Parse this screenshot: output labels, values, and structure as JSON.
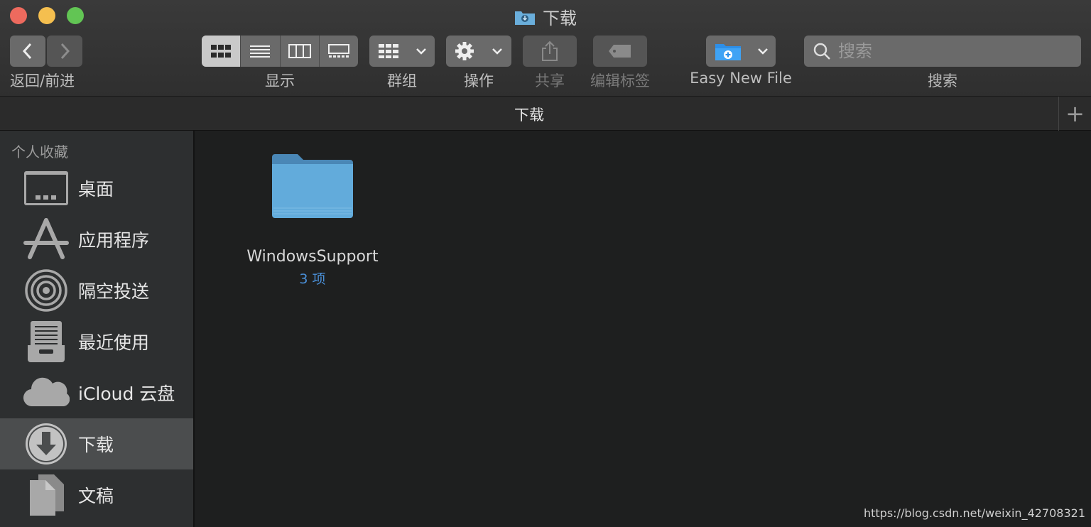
{
  "window": {
    "title": "下载"
  },
  "toolbar": {
    "nav_label": "返回/前进",
    "view_label": "显示",
    "group_label": "群组",
    "action_label": "操作",
    "share_label": "共享",
    "tags_label": "编辑标签",
    "easy_new_file_label": "Easy New File",
    "search_label": "搜索",
    "search_placeholder": "搜索"
  },
  "tabbar": {
    "title": "下载"
  },
  "sidebar": {
    "header": "个人收藏",
    "items": [
      {
        "label": "桌面",
        "icon": "desktop-icon"
      },
      {
        "label": "应用程序",
        "icon": "applications-icon"
      },
      {
        "label": "隔空投送",
        "icon": "airdrop-icon"
      },
      {
        "label": "最近使用",
        "icon": "recents-icon"
      },
      {
        "label": "iCloud 云盘",
        "icon": "icloud-icon"
      },
      {
        "label": "下载",
        "icon": "downloads-icon",
        "selected": true
      },
      {
        "label": "文稿",
        "icon": "documents-icon"
      }
    ]
  },
  "content": {
    "files": [
      {
        "name": "WindowsSupport",
        "detail": "3 项",
        "icon": "folder-icon"
      }
    ]
  },
  "watermark": "https://blog.csdn.net/weixin_42708321",
  "colors": {
    "accent": "#4a90d9",
    "folder": "#5fa8d8",
    "selected": "#4b4d4e"
  }
}
